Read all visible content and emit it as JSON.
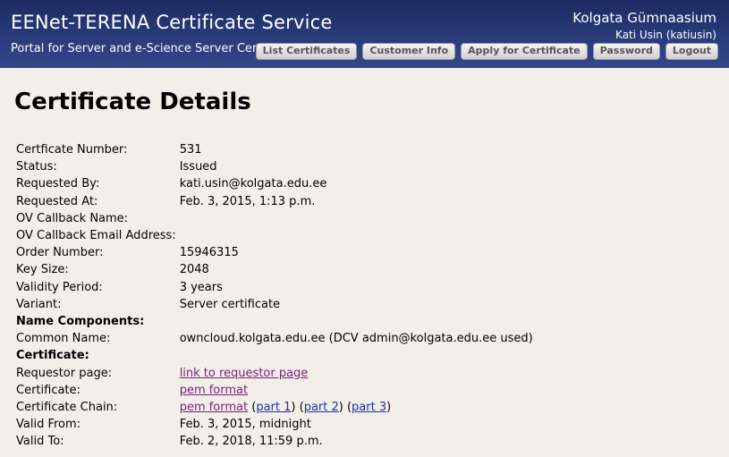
{
  "header": {
    "title": "EENet-TERENA Certificate Service",
    "subtitle": "Portal for Server and e-Science Server Certificates",
    "org": "Kolgata Gümnaasium",
    "user": "Kati Usin (katiusin)",
    "nav": [
      "List Certificates",
      "Customer Info",
      "Apply for Certificate",
      "Password",
      "Logout"
    ]
  },
  "page_title": "Certificate Details",
  "details": {
    "certificate_number": {
      "label": "Certficate Number:",
      "value": "531"
    },
    "status": {
      "label": "Status:",
      "value": "Issued"
    },
    "requested_by": {
      "label": "Requested By:",
      "value": "kati.usin@kolgata.edu.ee"
    },
    "requested_at": {
      "label": "Requested At:",
      "value": "Feb. 3, 2015, 1:13 p.m."
    },
    "ov_callback_name": {
      "label": "OV Callback Name:",
      "value": ""
    },
    "ov_callback_email": {
      "label": "OV Callback Email Address:",
      "value": ""
    },
    "order_number": {
      "label": "Order Number:",
      "value": "15946315"
    },
    "key_size": {
      "label": "Key Size:",
      "value": "2048"
    },
    "validity_period": {
      "label": "Validity Period:",
      "value": "3 years"
    },
    "variant": {
      "label": "Variant:",
      "value": "Server certificate"
    },
    "name_components_heading": "Name Components:",
    "common_name": {
      "label": "Common Name:",
      "value": "owncloud.kolgata.edu.ee (DCV admin@kolgata.edu.ee used)"
    },
    "certificate_heading": "Certificate:",
    "requestor_page": {
      "label": "Requestor page:",
      "link": "link to requestor page"
    },
    "certificate": {
      "label": "Certificate:",
      "link": "pem format"
    },
    "certificate_chain": {
      "label": "Certificate Chain:",
      "pem_link": "pem format",
      "part1": "part 1",
      "part2": "part 2",
      "part3": "part 3"
    },
    "valid_from": {
      "label": "Valid From:",
      "value": "Feb. 3, 2015, midnight"
    },
    "valid_to": {
      "label": "Valid To:",
      "value": "Feb. 2, 2018, 11:59 p.m."
    }
  },
  "colors": {
    "header_bg": "#26387a",
    "page_bg": "#f2efe8",
    "visited_link": "#7a1f7d",
    "link": "#1f2fb0"
  }
}
